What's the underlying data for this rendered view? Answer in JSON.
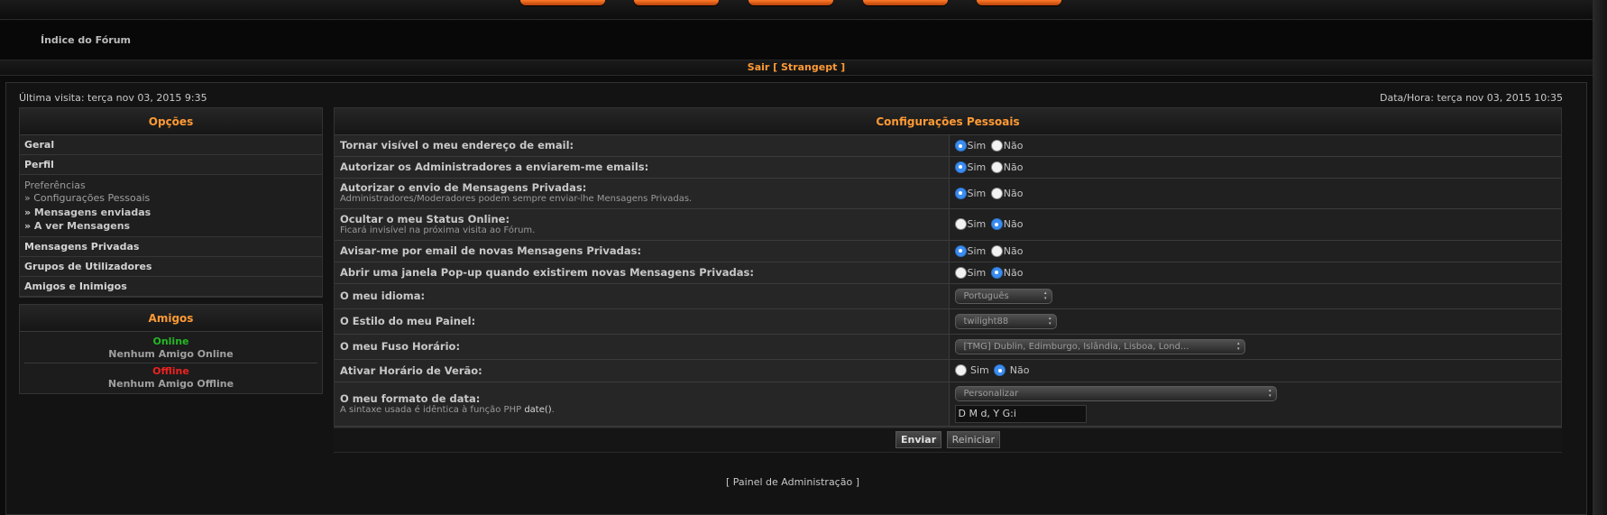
{
  "header": {
    "forum_index": "Índice do Fórum",
    "logout": "Sair [ Strangept ]"
  },
  "info": {
    "last_visit": "Última visita: terça nov 03, 2015 9:35",
    "datetime": "Data/Hora: terça nov 03, 2015 10:35"
  },
  "sidebar": {
    "title": "Opções",
    "general": "Geral",
    "profile": "Perfil",
    "preferences": "Preferências",
    "sub_personal": "» Configurações Pessoais",
    "sub_sent": "» Mensagens enviadas",
    "sub_viewing": "» A ver Mensagens",
    "private_messages": "Mensagens Privadas",
    "user_groups": "Grupos de Utilizadores",
    "friends_foes": "Amigos e Inimigos"
  },
  "friends": {
    "title": "Amigos",
    "online_label": "Online",
    "online_none": "Nenhum Amigo Online",
    "offline_label": "Offline",
    "offline_none": "Nenhum Amigo Offline"
  },
  "settings": {
    "title": "Configurações Pessoais",
    "yes": "Sim",
    "no": "Não",
    "rows": {
      "email_visible": "Tornar visível o meu endereço de email:",
      "admin_emails": "Autorizar os Administradores a enviarem-me emails:",
      "allow_pm": "Autorizar o envio de Mensagens Privadas:",
      "allow_pm_desc": "Administradores/Moderadores podem sempre enviar-lhe Mensagens Privadas.",
      "hide_online": "Ocultar o meu Status Online:",
      "hide_online_desc": "Ficará invisível na próxima visita ao Fórum.",
      "notify_pm": "Avisar-me por email de novas Mensagens Privadas:",
      "popup_pm": "Abrir uma janela Pop-up quando existirem novas Mensagens Privadas:",
      "language": "O meu idioma:",
      "style": "O Estilo do meu Painel:",
      "timezone": "O meu Fuso Horário:",
      "dst": "Ativar Horário de Verão:",
      "date_format": "O meu formato de data:",
      "date_format_desc": "A sintaxe usada é idêntica à função PHP",
      "date_format_fn": "date()"
    },
    "values": {
      "language": "Português",
      "style": "twilight88",
      "timezone": "[TMG] Dublin, Edimburgo, Islândia, Lisboa, Lond...",
      "date_preset": "Personalizar",
      "date_custom": "D M d, Y G:i"
    },
    "submit": "Enviar",
    "reset": "Reiniciar"
  },
  "footer": {
    "admin_panel": "[ Painel de Administração ]"
  }
}
